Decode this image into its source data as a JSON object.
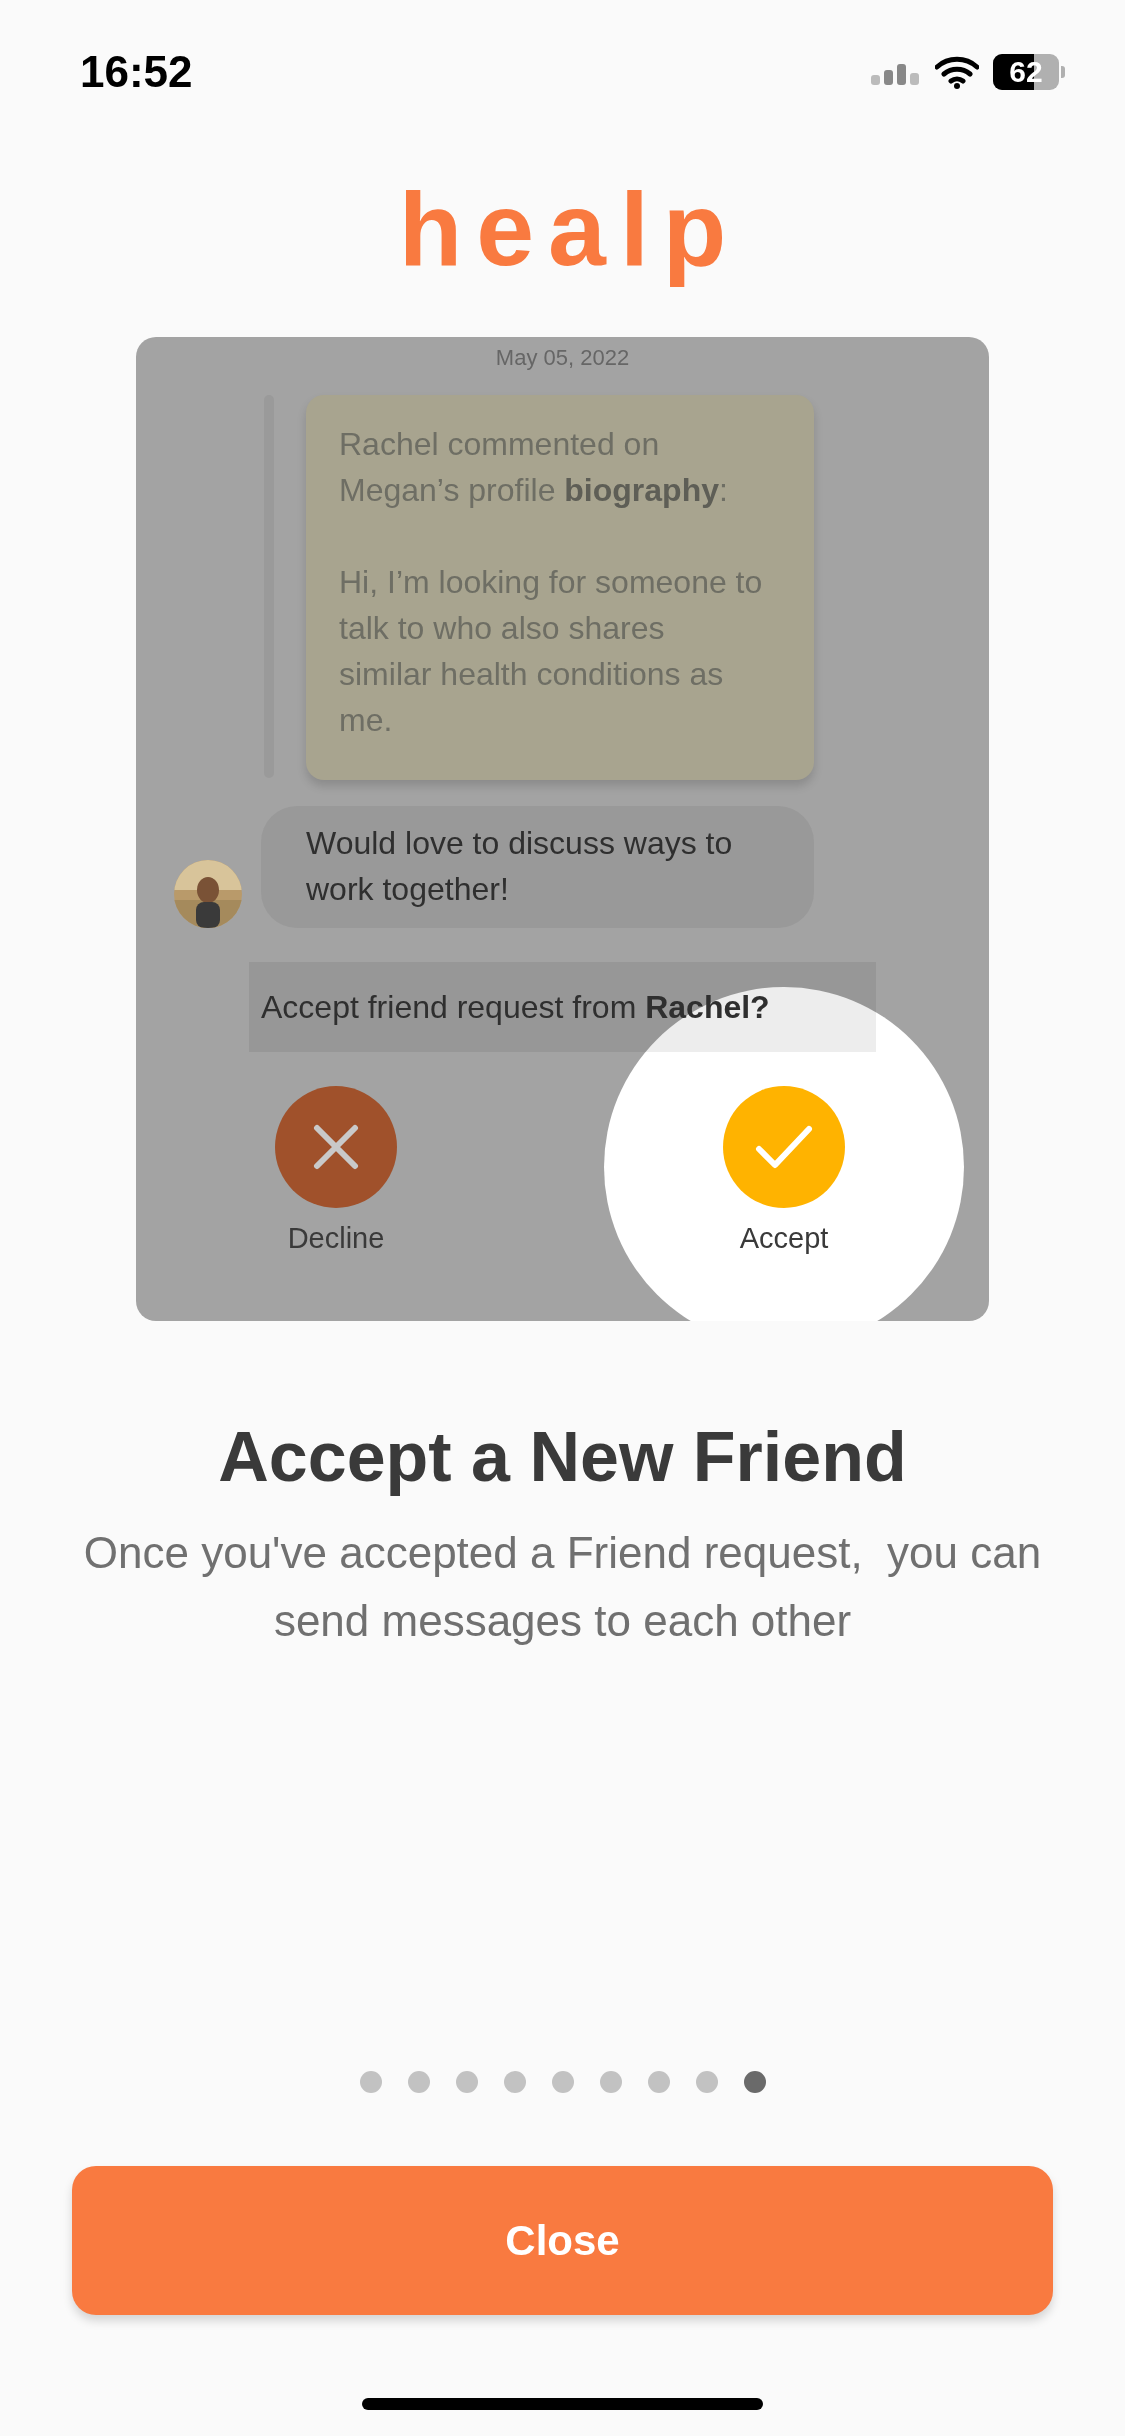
{
  "status_bar": {
    "time": "16:52",
    "battery": "62"
  },
  "logo": "healp",
  "illustration": {
    "date": "May 05, 2022",
    "note": [
      "Rachel commented on Megan’s profile **biography**:",
      "Hi, I’m looking for someone to talk to who also shares similar health conditions as me."
    ],
    "message": "Would love to discuss ways to work together!",
    "request": "Accept friend request from **Rachel?**",
    "actions": [
      {
        "kind": "decline",
        "label": "Decline",
        "highlighted": false
      },
      {
        "kind": "accept",
        "label": "Accept",
        "highlighted": true
      }
    ]
  },
  "title": "Accept a New Friend",
  "description": "Once you've accepted a Friend request,  you can send messages to each other",
  "pages": [
    {
      "selected": false
    },
    {
      "selected": false
    },
    {
      "selected": false
    },
    {
      "selected": false
    },
    {
      "selected": false
    },
    {
      "selected": false
    },
    {
      "selected": false
    },
    {
      "selected": false
    },
    {
      "selected": true
    }
  ],
  "button": "Close"
}
